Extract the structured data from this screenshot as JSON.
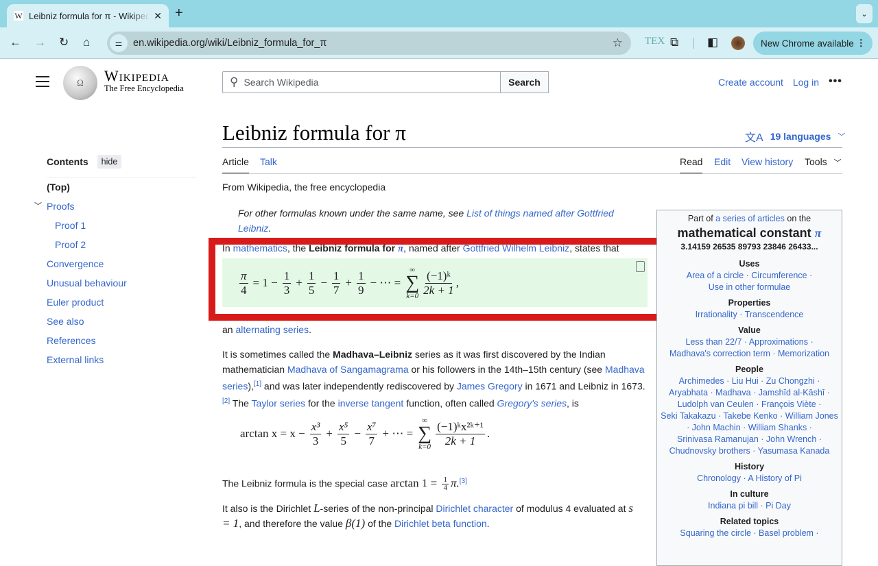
{
  "browser": {
    "tab_title": "Leibniz formula for π - Wikipedia",
    "tab_favicon": "W",
    "url": "en.wikipedia.org/wiki/Leibniz_formula_for_π",
    "new_chrome": "New Chrome available",
    "icons": [
      "back-icon",
      "forward-icon",
      "reload-icon",
      "home-icon",
      "site-settings-icon",
      "bookmark-star-icon",
      "tex-extension-icon",
      "extensions-puzzle-icon",
      "side-panel-icon",
      "profile-avatar"
    ]
  },
  "header": {
    "wordmark": "Wikipedia",
    "tagline": "The Free Encyclopedia",
    "search_placeholder": "Search Wikipedia",
    "search_button": "Search",
    "create_account": "Create account",
    "log_in": "Log in",
    "more": "•••"
  },
  "toc": {
    "title": "Contents",
    "hide": "hide",
    "items": [
      {
        "label": "(Top)"
      },
      {
        "label": "Proofs"
      },
      {
        "label": "Proof 1"
      },
      {
        "label": "Proof 2"
      },
      {
        "label": "Convergence"
      },
      {
        "label": "Unusual behaviour"
      },
      {
        "label": "Euler product"
      },
      {
        "label": "See also"
      },
      {
        "label": "References"
      },
      {
        "label": "External links"
      }
    ]
  },
  "article": {
    "title": "Leibniz formula for π",
    "languages": "19 languages",
    "tabs": {
      "article": "Article",
      "talk": "Talk",
      "read": "Read",
      "edit": "Edit",
      "history": "View history",
      "tools": "Tools"
    },
    "from": "From Wikipedia, the free encyclopedia",
    "hatnote": {
      "pre": "For other formulas known under the same name, see ",
      "link": "List of things named after Gottfried Leibniz",
      "post": "."
    },
    "intro": {
      "t1": "In ",
      "l1": "mathematics",
      "t2": ", the ",
      "b1": "Leibniz formula for ",
      "b2": "π",
      "t3": ", named after ",
      "l2": "Gottfried Wilhelm Leibniz",
      "t4": ", states that"
    },
    "formula1": {
      "lhs_num": "π",
      "lhs_den": "4",
      "terms": [
        "= 1 −",
        "+",
        "−",
        "+",
        "− ⋯ ="
      ],
      "dens": [
        "3",
        "5",
        "7",
        "9"
      ],
      "sum_top": "∞",
      "sum_bot": "k=0",
      "rnum": "(−1)ᵏ",
      "rden": "2k + 1",
      "tail": ","
    },
    "after_formula": {
      "t1": "an ",
      "l1": "alternating series",
      "t2": "."
    },
    "para2": {
      "t1": "It is sometimes called the ",
      "b1": "Madhava–Leibniz",
      "t2": " series as it was first discovered by the Indian mathematician ",
      "l1": "Madhava of Sangamagrama",
      "t3": " or his followers in the 14th–15th century (see ",
      "l2": "Madhava series",
      "t4": "),",
      "r1": "[1]",
      "t5": " and was later independently rediscovered by ",
      "l3": "James Gregory",
      "t6": " in 1671 and Leibniz in 1673.",
      "r2": "[2]",
      "t7": " The ",
      "l4": "Taylor series",
      "t8": " for the ",
      "l5": "inverse tangent",
      "t9": " function, often called ",
      "l6": "Gregory's series",
      "t10": ", is"
    },
    "formula2": {
      "lhs": "arctan x = x −",
      "n1": "x³",
      "d1": "3",
      "n2": "x⁵",
      "d2": "5",
      "n3": "x⁷",
      "d3": "7",
      "mid": "+ ⋯ =",
      "sum_top": "∞",
      "sum_bot": "k=0",
      "rnum": "(−1)ᵏx²ᵏ⁺¹",
      "rden": "2k + 1",
      "tail": "."
    },
    "para3": {
      "t1": "The Leibniz formula is the special case ",
      "m1": "arctan 1 = ",
      "fn": "1",
      "fd": "4",
      "m2": "π.",
      "r1": "[3]"
    },
    "para4": {
      "t1": "It also is the Dirichlet ",
      "m1": "L",
      "t2": "-series of the non-principal ",
      "l1": "Dirichlet character",
      "t3": " of modulus 4 evaluated at ",
      "m2": "s = 1",
      "t4": ", and therefore the value ",
      "m3": "β(1)",
      "t5": " of the ",
      "l2": "Dirichlet beta function",
      "t6": "."
    }
  },
  "infobox": {
    "pre": "Part of ",
    "link": "a series of articles",
    "post": " on the",
    "title": "mathematical constant ",
    "title_pi": "π",
    "digits": "3.14159 26535 89793 23846 26433...",
    "sections": [
      {
        "name": "Uses",
        "lines": [
          "Area of a circle · Circumference ·",
          "Use in other formulae"
        ]
      },
      {
        "name": "Properties",
        "lines": [
          "Irrationality · Transcendence"
        ]
      },
      {
        "name": "Value",
        "lines": [
          "Less than 22/7 · Approximations ·",
          "Madhava's correction term · Memorization"
        ]
      },
      {
        "name": "People",
        "lines": [
          "Archimedes · Liu Hui · Zu Chongzhi ·",
          "Aryabhata · Madhava · Jamshīd al-Kāshī ·",
          "Ludolph van Ceulen · François Viète ·",
          "Seki Takakazu · Takebe Kenko · William Jones",
          "· John Machin · William Shanks ·",
          "Srinivasa Ramanujan · John Wrench ·",
          "Chudnovsky brothers · Yasumasa Kanada"
        ]
      },
      {
        "name": "History",
        "lines": [
          "Chronology · A History of Pi"
        ]
      },
      {
        "name": "In culture",
        "lines": [
          "Indiana pi bill · Pi Day"
        ]
      },
      {
        "name": "Related topics",
        "lines": [
          "Squaring the circle · Basel problem ·"
        ]
      }
    ]
  },
  "highlight": {
    "color": "#d91a1a"
  }
}
